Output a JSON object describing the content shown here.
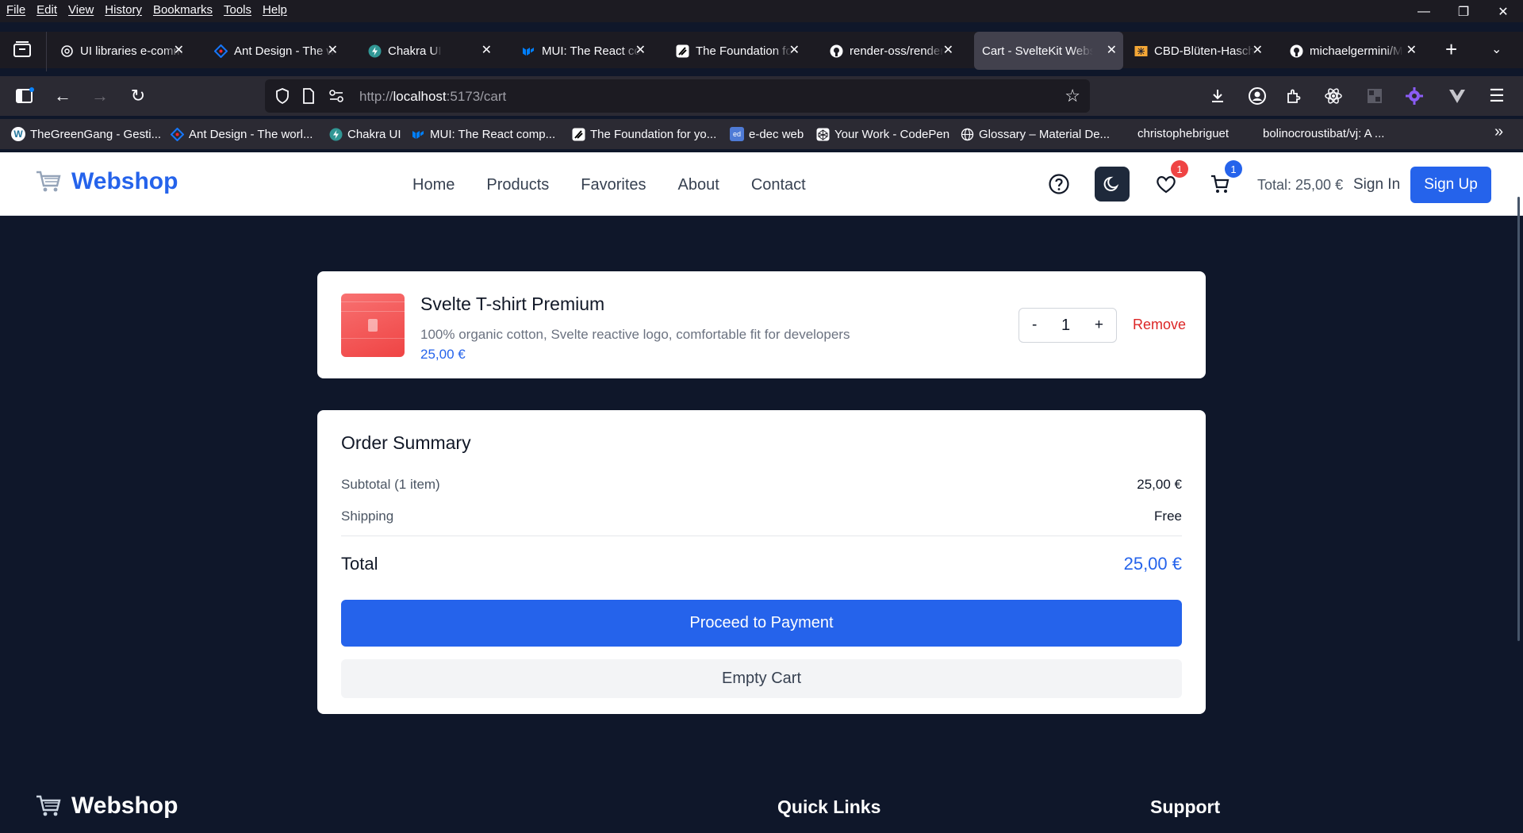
{
  "menubar": {
    "items": [
      "File",
      "Edit",
      "View",
      "History",
      "Bookmarks",
      "Tools",
      "Help"
    ],
    "window_controls": [
      "minimize",
      "restore",
      "close"
    ]
  },
  "tabs": [
    {
      "title": "UI libraries e-comm",
      "icon": "openai-icon",
      "active": false
    },
    {
      "title": "Ant Design - The w",
      "icon": "antdesign-icon",
      "active": false
    },
    {
      "title": "Chakra UI",
      "icon": "chakra-icon",
      "active": false
    },
    {
      "title": "MUI: The React co",
      "icon": "mui-icon",
      "active": false
    },
    {
      "title": "The Foundation fo",
      "icon": "foundation-icon",
      "active": false
    },
    {
      "title": "render-oss/render",
      "icon": "github-icon",
      "active": false
    },
    {
      "title": "Cart - SvelteKit Websh",
      "icon": "none",
      "active": true
    },
    {
      "title": "CBD-Blüten-Hasch",
      "icon": "cbd-icon",
      "active": false
    },
    {
      "title": "michaelgermini/M",
      "icon": "github-icon",
      "active": false
    }
  ],
  "address": {
    "url_prefix": "http://",
    "url_host": "localhost",
    "url_rest": ":5173/cart"
  },
  "bookmarks": [
    {
      "label": "TheGreenGang - Gesti...",
      "icon": "wordpress-icon"
    },
    {
      "label": "Ant Design - The worl...",
      "icon": "antdesign-icon"
    },
    {
      "label": "Chakra UI",
      "icon": "chakra-icon"
    },
    {
      "label": "MUI: The React comp...",
      "icon": "mui-icon"
    },
    {
      "label": "The Foundation for yo...",
      "icon": "foundation-icon"
    },
    {
      "label": "e-dec web",
      "icon": "edec-icon"
    },
    {
      "label": "Your Work - CodePen",
      "icon": "codepen-icon"
    },
    {
      "label": "Glossary – Material De...",
      "icon": "globe-icon"
    },
    {
      "label": "christophebriguet",
      "icon": "none"
    },
    {
      "label": "bolinocroustibat/vj: A ...",
      "icon": "none"
    }
  ],
  "site": {
    "brand": "Webshop",
    "nav": [
      "Home",
      "Products",
      "Favorites",
      "About",
      "Contact"
    ],
    "favorites_count": "1",
    "cart_count": "1",
    "header_total": "Total: 25,00 €",
    "sign_in": "Sign In",
    "sign_up": "Sign Up",
    "colors": {
      "primary": "#2563eb",
      "danger": "#dc2626",
      "page_bg": "#0f172a"
    }
  },
  "cart_item": {
    "name": "Svelte T-shirt Premium",
    "description": "100% organic cotton, Svelte reactive logo, comfortable fit for developers",
    "price": "25,00 €",
    "quantity": "1",
    "minus": "-",
    "plus": "+",
    "remove": "Remove"
  },
  "summary": {
    "title": "Order Summary",
    "subtotal_label": "Subtotal (1 item)",
    "subtotal_value": "25,00 €",
    "shipping_label": "Shipping",
    "shipping_value": "Free",
    "total_label": "Total",
    "total_value": "25,00 €",
    "pay_button": "Proceed to Payment",
    "empty_button": "Empty Cart"
  },
  "footer": {
    "brand": "Webshop",
    "quick_links": "Quick Links",
    "support": "Support"
  }
}
